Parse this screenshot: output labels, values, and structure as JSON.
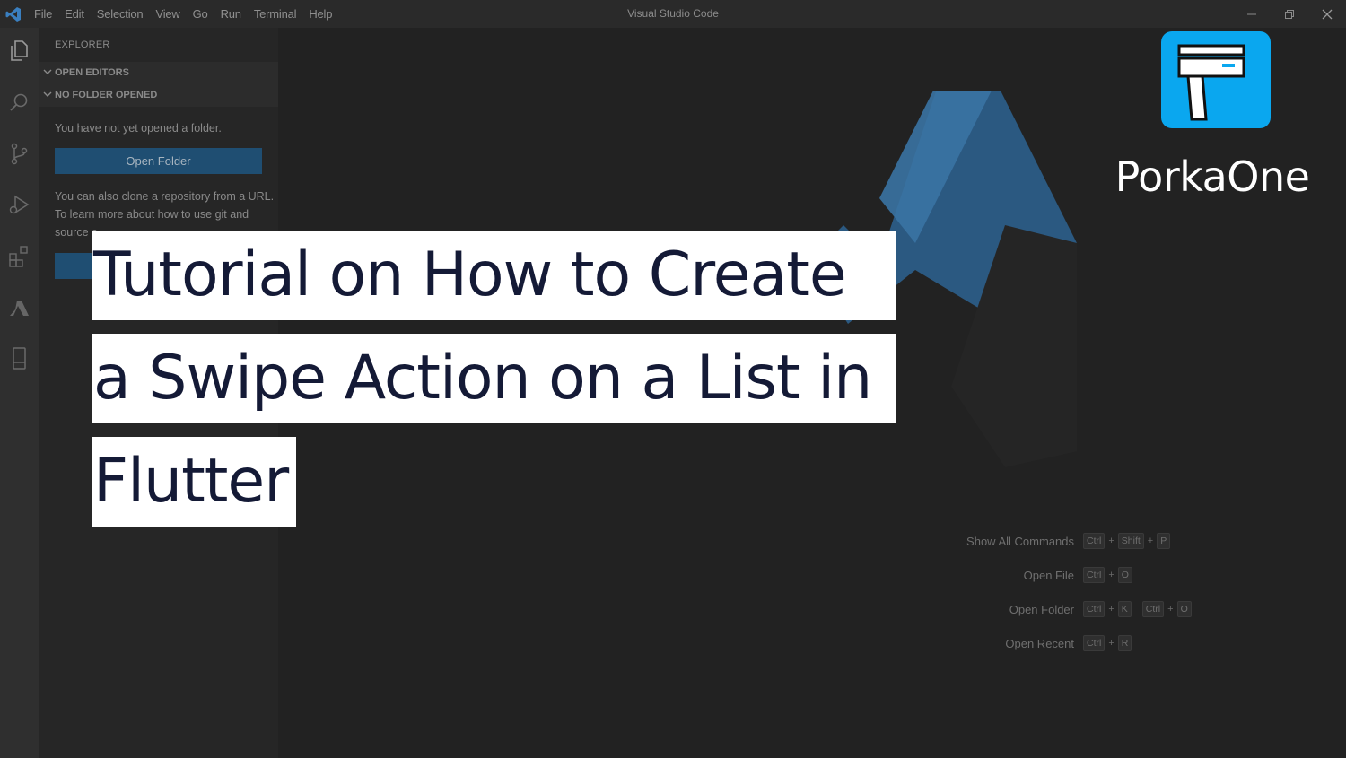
{
  "app": {
    "title": "Visual Studio Code",
    "menu": [
      "File",
      "Edit",
      "Selection",
      "View",
      "Go",
      "Run",
      "Terminal",
      "Help"
    ]
  },
  "activity_bar": {
    "icons": [
      "explorer-icon",
      "search-icon",
      "source-control-icon",
      "run-debug-icon",
      "extensions-icon",
      "azure-icon",
      "device-icon"
    ]
  },
  "sidebar": {
    "title": "EXPLORER",
    "open_editors": "OPEN EDITORS",
    "no_folder": "NO FOLDER OPENED",
    "message": "You have not yet opened a folder.",
    "open_folder_button": "Open Folder",
    "clone_line1": "You can also clone a repository from a URL.",
    "clone_line2": "To learn more about how to use git and",
    "clone_line3": "source c"
  },
  "shortcuts": [
    {
      "label": "Show All Commands",
      "keys": [
        [
          "Ctrl",
          "Shift",
          "P"
        ]
      ]
    },
    {
      "label": "Open File",
      "keys": [
        [
          "Ctrl",
          "O"
        ]
      ]
    },
    {
      "label": "Open Folder",
      "keys": [
        [
          "Ctrl",
          "K"
        ],
        [
          "Ctrl",
          "O"
        ]
      ]
    },
    {
      "label": "Open Recent",
      "keys": [
        [
          "Ctrl",
          "R"
        ]
      ]
    }
  ],
  "overlay": {
    "line1": "Tutorial on How to Create",
    "line2": "a Swipe Action on a List in",
    "line3": "Flutter"
  },
  "brand": {
    "name": "PorkaOne",
    "color": "#0aa7ef"
  },
  "colors": {
    "accent_button": "#1f4e72",
    "watermark": "#2d5f8a"
  }
}
